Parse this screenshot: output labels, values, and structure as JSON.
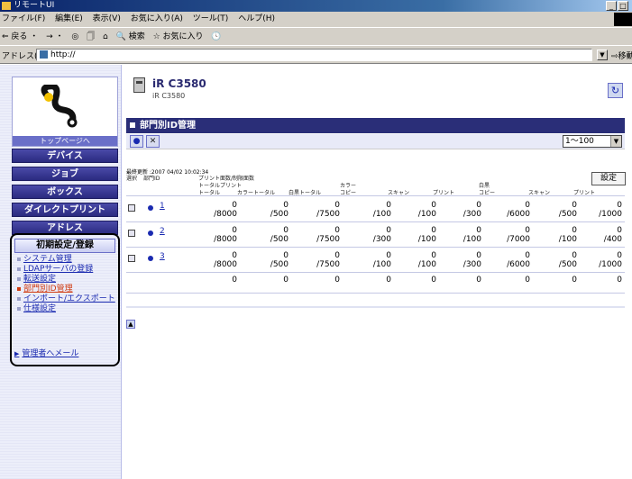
{
  "window": {
    "title": "リモートUI",
    "controls": [
      "_",
      "□",
      "×"
    ]
  },
  "menubar": [
    "ファイル(F)",
    "編集(E)",
    "表示(V)",
    "お気に入り(A)",
    "ツール(T)",
    "ヘルプ(H)"
  ],
  "toolbar": [
    "⇐ 戻る ・",
    "→ ・",
    "◎",
    "🗍",
    "⌂",
    "🔍 検索",
    "☆ お気に入り",
    "🕓"
  ],
  "address": {
    "label": "アドレス(D)",
    "url": "http://",
    "go": "移動"
  },
  "sidebar": {
    "top_page": "トップページへ",
    "nav": [
      "デバイス",
      "ジョブ",
      "ボックス",
      "ダイレクトプリント",
      "アドレス"
    ],
    "setup_title": "初期設定/登録",
    "sublinks": [
      "システム管理",
      "LDAPサーバの登録",
      "転送設定",
      "部門別ID管理",
      "インポート/エクスポート",
      "仕様設定"
    ],
    "active_index": 3,
    "admin_mail": "管理者へメール"
  },
  "device": {
    "name": "iR C3580",
    "sub": "iR C3580"
  },
  "panel": {
    "title": "部門別ID管理",
    "settings_button": "設定",
    "range": "1〜100",
    "updated": "最終更新 :2007 04/02 10:02:34",
    "headers": {
      "select": "選択",
      "dept_id": "部門ID",
      "print_counts": "プリント面数/制限面数",
      "total_print": "トータルプリント",
      "color": "カラー",
      "bw": "白黒",
      "cols": [
        "トータル",
        "カラートータル",
        "白黒トータル",
        "コピー",
        "スキャン",
        "プリント",
        "コピー",
        "スキャン",
        "プリント"
      ]
    }
  },
  "rows": [
    {
      "id": "1",
      "values": [
        [
          "0",
          "/8000"
        ],
        [
          "0",
          "/500"
        ],
        [
          "0",
          "/7500"
        ],
        [
          "0",
          "/100"
        ],
        [
          "0",
          "/100"
        ],
        [
          "0",
          "/300"
        ],
        [
          "0",
          "/6000"
        ],
        [
          "0",
          "/500"
        ],
        [
          "0",
          "/1000"
        ]
      ]
    },
    {
      "id": "2",
      "values": [
        [
          "0",
          "/8000"
        ],
        [
          "0",
          "/500"
        ],
        [
          "0",
          "/7500"
        ],
        [
          "0",
          "/300"
        ],
        [
          "0",
          "/100"
        ],
        [
          "0",
          "/100"
        ],
        [
          "0",
          "/7000"
        ],
        [
          "0",
          "/100"
        ],
        [
          "0",
          "/400"
        ]
      ]
    },
    {
      "id": "3",
      "values": [
        [
          "0",
          "/8000"
        ],
        [
          "0",
          "/500"
        ],
        [
          "0",
          "/7500"
        ],
        [
          "0",
          "/100"
        ],
        [
          "0",
          "/100"
        ],
        [
          "0",
          "/300"
        ],
        [
          "0",
          "/6000"
        ],
        [
          "0",
          "/500"
        ],
        [
          "0",
          "/1000"
        ]
      ]
    }
  ],
  "totals": [
    "0",
    "0",
    "0",
    "0",
    "0",
    "0",
    "0",
    "0",
    "0"
  ]
}
